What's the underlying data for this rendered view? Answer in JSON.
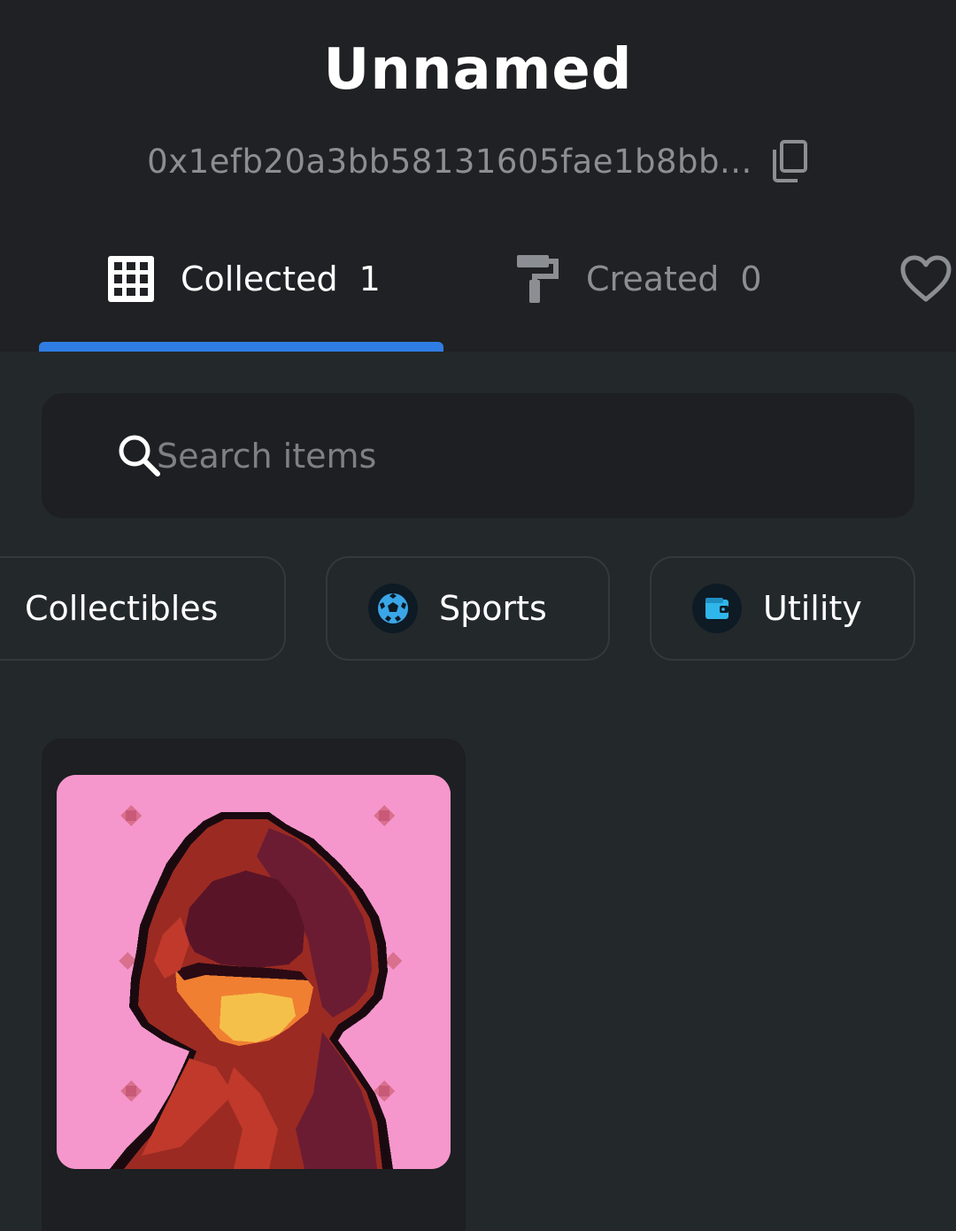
{
  "profile": {
    "name": "Unnamed",
    "address": "0x1efb20a3bb58131605fae1b8bb..."
  },
  "tabs": [
    {
      "label": "Collected",
      "count": "1",
      "icon": "grid-icon",
      "active": true
    },
    {
      "label": "Created",
      "count": "0",
      "icon": "paint-roller-icon",
      "active": false
    },
    {
      "label": "",
      "icon": "heart-icon",
      "active": false
    }
  ],
  "search": {
    "placeholder": "Search items",
    "value": ""
  },
  "categories": [
    {
      "label": "Collectibles"
    },
    {
      "label": "Sports",
      "icon": "soccer-ball-icon"
    },
    {
      "label": "Utility",
      "icon": "wallet-icon"
    }
  ],
  "items": [
    {
      "image": "pixel-art-hooded-figure",
      "background_color": "#f597cc"
    }
  ],
  "colors": {
    "background": "#23282b",
    "header_background": "#202124",
    "accent": "#2f7de4",
    "muted_text": "#8b8e92",
    "card_background": "#1d1f22"
  }
}
